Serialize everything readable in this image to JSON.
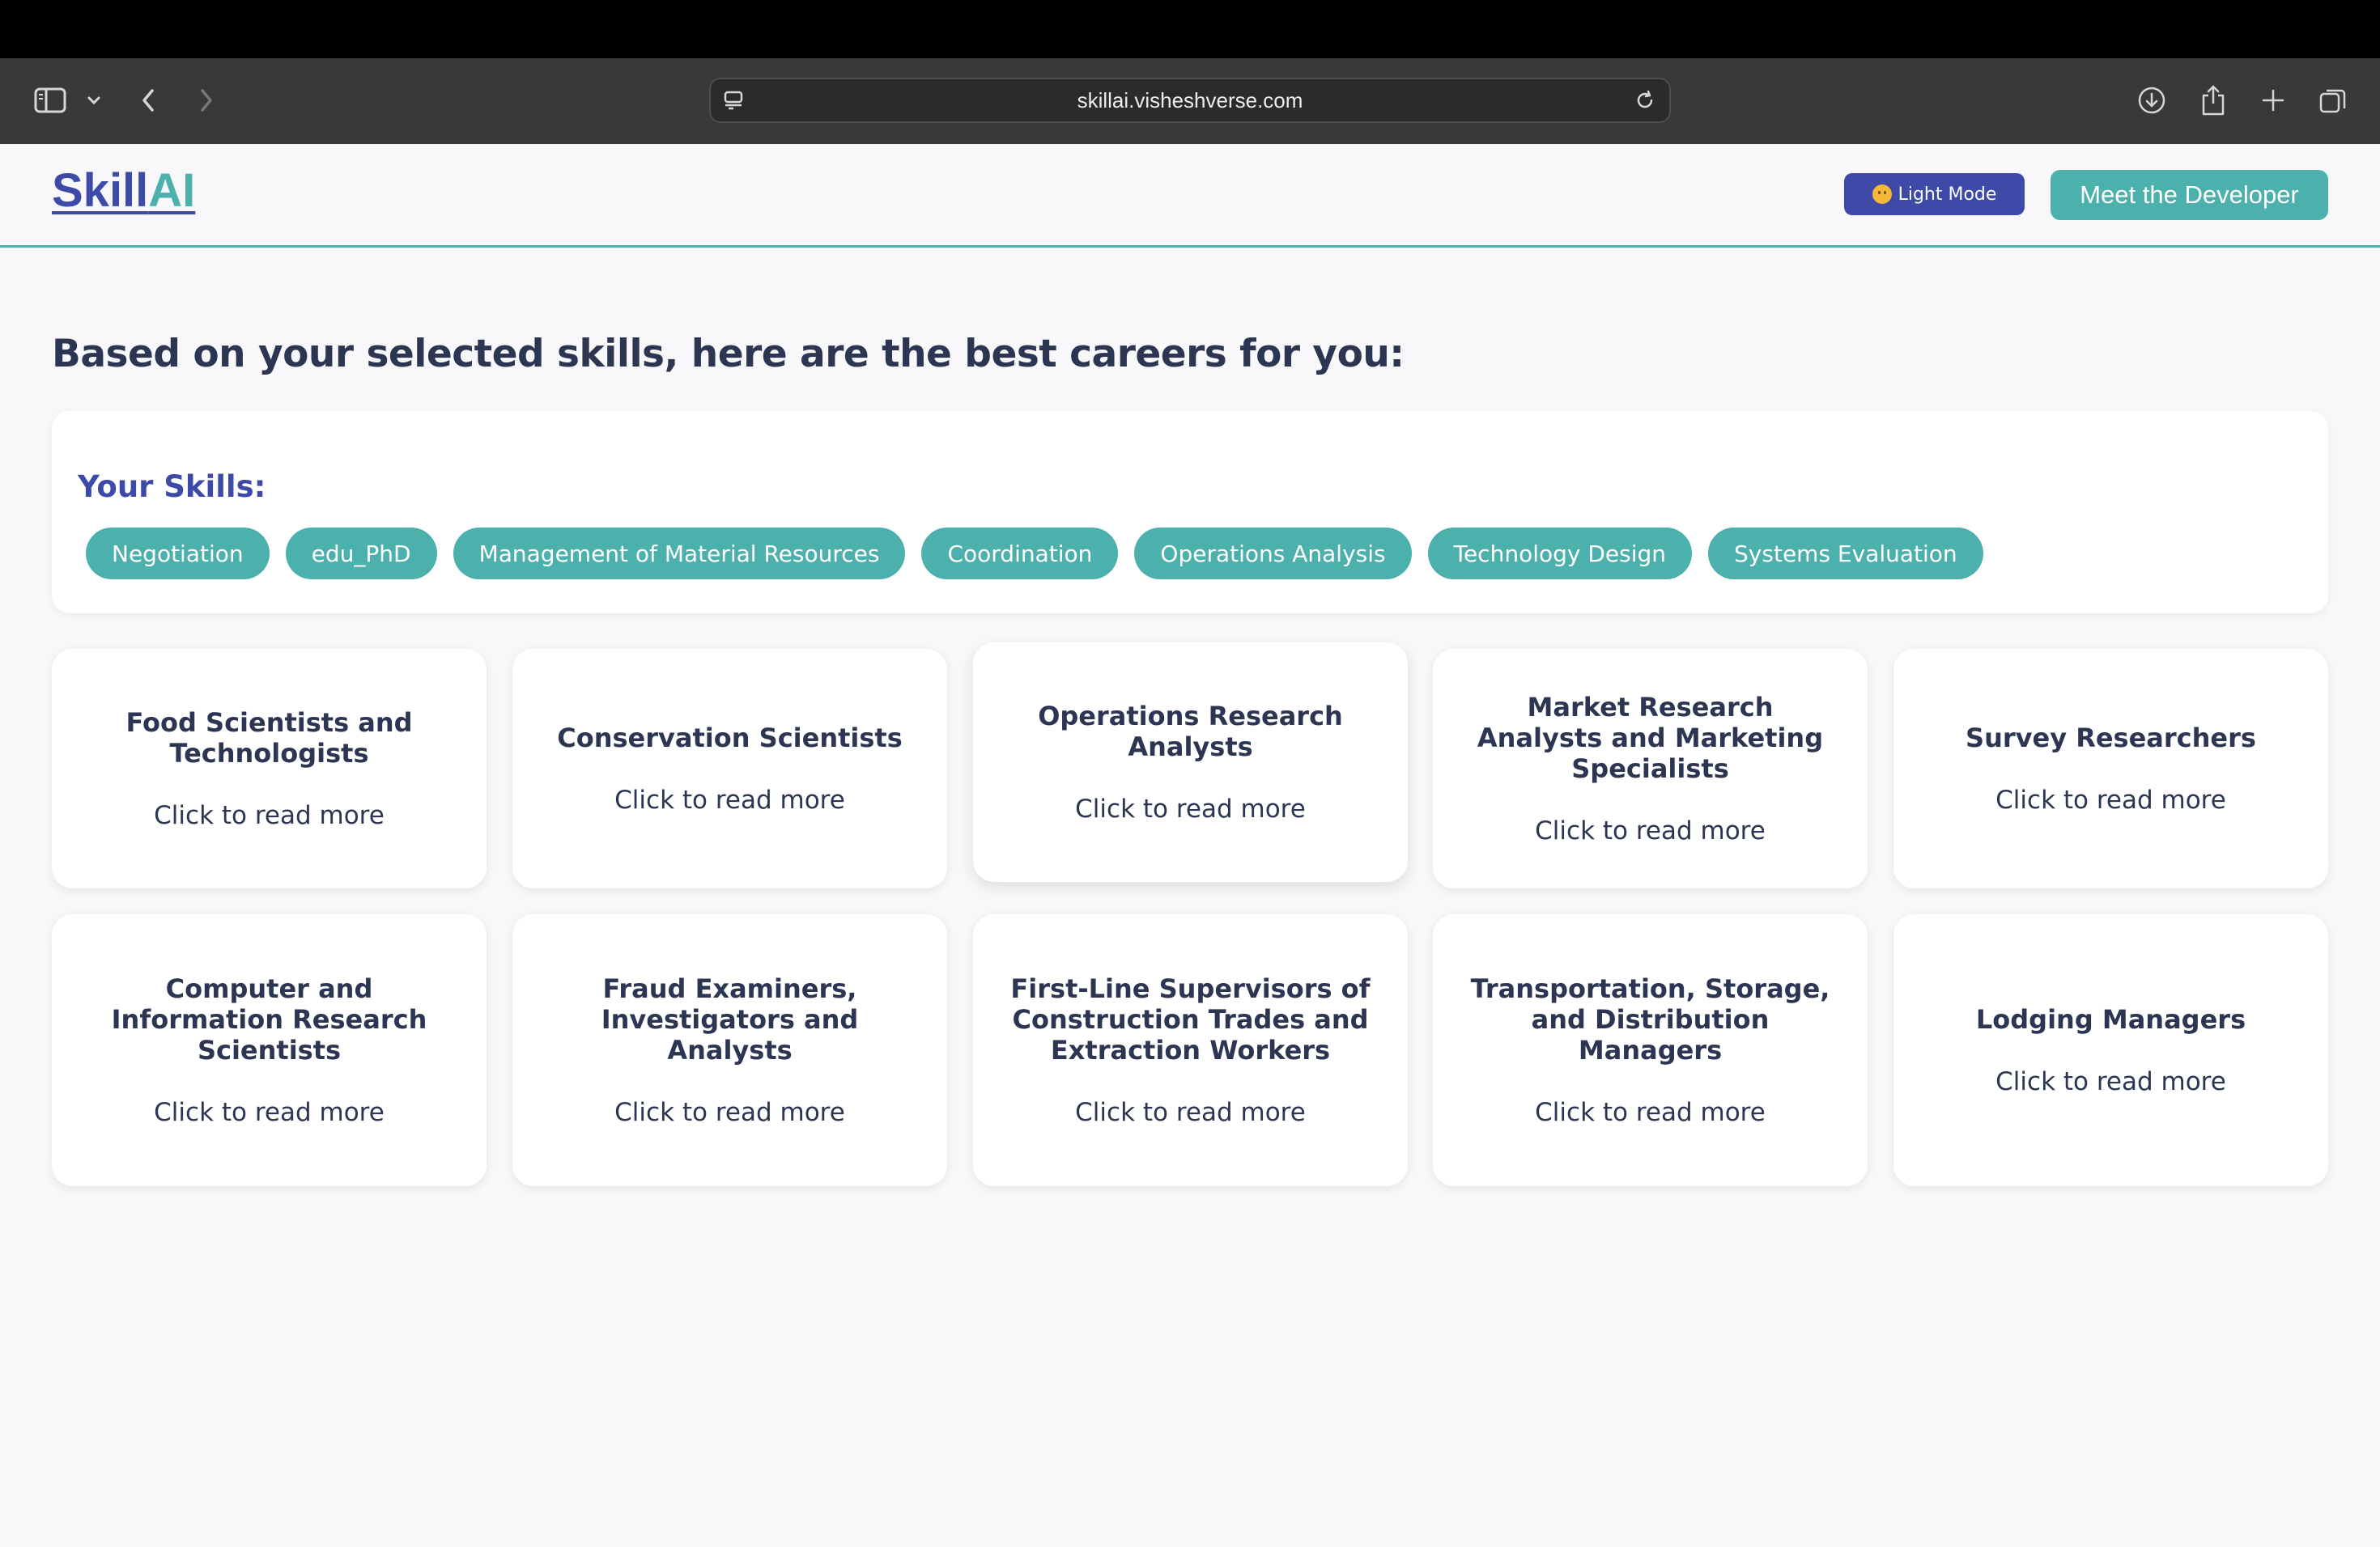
{
  "browser": {
    "url": "skillai.visheshverse.com"
  },
  "header": {
    "logo_part1": "Skill",
    "logo_part2": "AI",
    "mode_label": "Light Mode",
    "developer_label": "Meet the Developer"
  },
  "main": {
    "heading": "Based on your selected skills, here are the best careers for you:",
    "skills_title": "Your Skills:",
    "skills": [
      "Negotiation",
      "edu_PhD",
      "Management of Material Resources",
      "Coordination",
      "Operations Analysis",
      "Technology Design",
      "Systems Evaluation"
    ],
    "read_more": "Click to read more",
    "careers": [
      "Food Scientists and Technologists",
      "Conservation Scientists",
      "Operations Research Analysts",
      "Market Research Analysts and Marketing Specialists",
      "Survey Researchers",
      "Computer and Information Research Scientists",
      "Fraud Examiners, Investigators and Analysts",
      "First-Line Supervisors of Construction Trades and Extraction Workers",
      "Transportation, Storage, and Distribution Managers",
      "Lodging Managers"
    ]
  },
  "colors": {
    "primary": "#3d4aa8",
    "accent": "#4cb0ad",
    "text": "#2c3652",
    "background": "#f8f8fa"
  },
  "icons": [
    "sidebar-icon",
    "chevron-down-icon",
    "back-icon",
    "forward-icon",
    "site-settings-icon",
    "reload-icon",
    "download-icon",
    "share-icon",
    "new-tab-icon",
    "tab-overview-icon"
  ]
}
